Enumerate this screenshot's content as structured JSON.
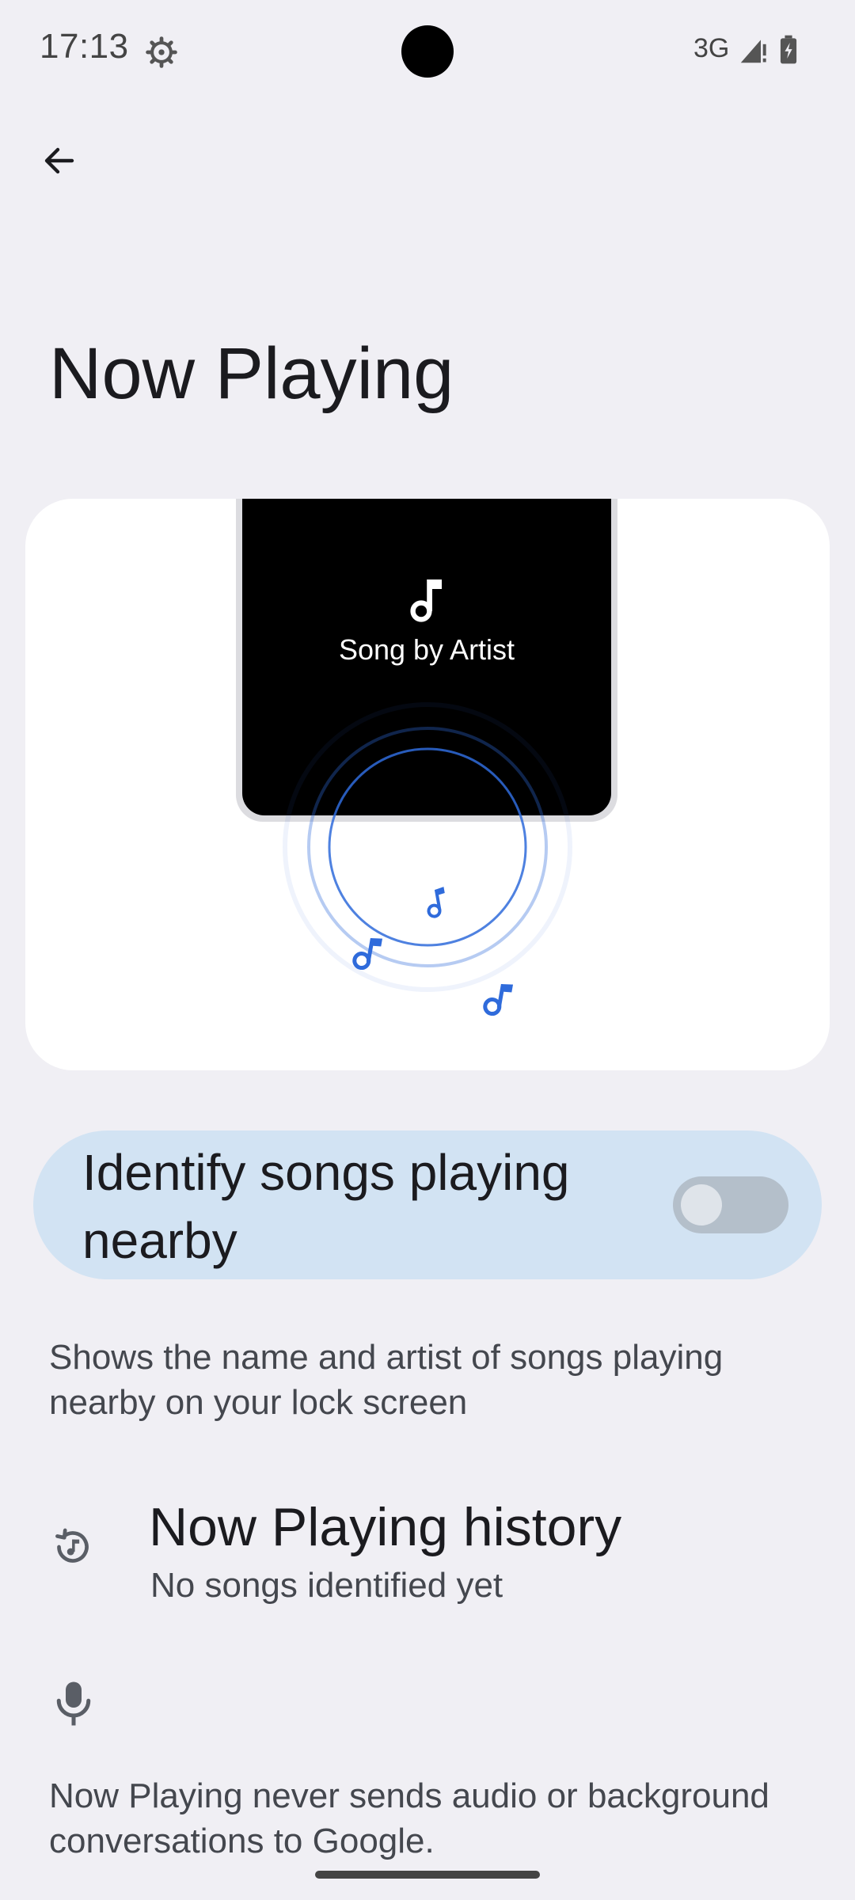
{
  "status_bar": {
    "time": "17:13",
    "network": "3G",
    "icons": [
      "gear-icon",
      "signal-icon",
      "battery-charging-icon"
    ]
  },
  "header": {
    "back_icon": "arrow-left-icon",
    "title": "Now Playing"
  },
  "illustration": {
    "song_label": "Song by Artist",
    "icons": [
      "music-note-icon"
    ],
    "accent_color": "#2f6bdb"
  },
  "identify_toggle": {
    "label": "Identify songs playing nearby",
    "state": "off",
    "background_color": "#d2e3f3"
  },
  "description": "Shows the name and artist of songs playing nearby on your lock screen",
  "history": {
    "icon": "history-music-icon",
    "title": "Now Playing history",
    "subtitle": "No songs identified yet"
  },
  "privacy": {
    "icon": "mic-icon",
    "text": "Now Playing never sends audio or background conversations to Google."
  }
}
